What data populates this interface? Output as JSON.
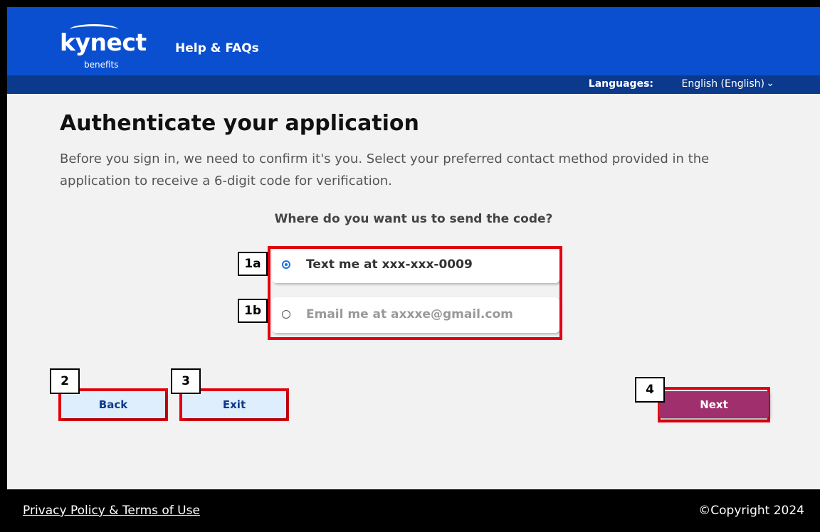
{
  "header": {
    "logo_text": "kynect",
    "logo_subtext": "benefits",
    "help_link": "Help & FAQs",
    "colors": {
      "primary": "#0a4fcf",
      "secondary": "#0b3a8d"
    }
  },
  "language_bar": {
    "label": "Languages:",
    "selected": "English (English)",
    "chevron": "chevron-down-icon"
  },
  "main": {
    "title": "Authenticate your application",
    "description": "Before you sign in, we need to confirm it's you. Select your preferred contact method provided in the application to receive a 6-digit code for verification.",
    "question": "Where do you want us to send the code?",
    "options": [
      {
        "label": "Text me at xxx-xxx-0009",
        "selected": true
      },
      {
        "label": "Email me at axxxe@gmail.com",
        "selected": false
      }
    ]
  },
  "buttons": {
    "back": "Back",
    "exit": "Exit",
    "next": "Next",
    "next_color": "#a0306d"
  },
  "callouts": {
    "opt1": "1a",
    "opt2": "1b",
    "back": "2",
    "exit": "3",
    "next": "4",
    "highlight_color": "#e3000f"
  },
  "footer": {
    "privacy": "Privacy Policy & Terms of Use",
    "copyright": "©Copyright 2024"
  }
}
